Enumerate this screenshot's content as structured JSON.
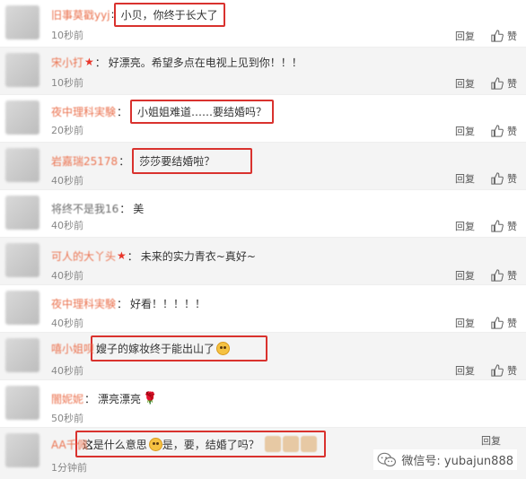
{
  "reply_label": "回复",
  "like_label": "赞",
  "comments": [
    {
      "user": "旧事莫戳yyj",
      "star": "",
      "sep": ":",
      "text": "小贝，你终于长大了",
      "time": "10秒前",
      "highlight": true
    },
    {
      "user": "宋小打",
      "star": "★",
      "sep": "：",
      "text": "好漂亮。希望多点在电视上见到你！！！",
      "time": "10秒前",
      "highlight": false
    },
    {
      "user": "夜中理科実験",
      "star": "",
      "sep": "：",
      "text": "小姐姐难道……要结婚吗？",
      "time": "20秒前",
      "highlight": true
    },
    {
      "user": "岩嘉瑞25178",
      "star": "",
      "sep": "：",
      "text": "莎莎要结婚啦？",
      "time": "40秒前",
      "highlight": true
    },
    {
      "user": "将终不是我16",
      "star": "",
      "sep": "：",
      "text": "美",
      "time": "40秒前",
      "highlight": false
    },
    {
      "user": "可人的大丫头",
      "star": "★",
      "sep": "：",
      "text": "未来的实力青衣~真好~",
      "time": "40秒前",
      "highlight": false
    },
    {
      "user": "夜中理科実験",
      "star": "",
      "sep": "：",
      "text": "好看！！！！！",
      "time": "40秒前",
      "highlight": false
    },
    {
      "user": "嘻小姐呗",
      "star": "",
      "sep": "：",
      "text": "嫂子的嫁妆终于能出山了",
      "time": "40秒前",
      "highlight": true
    },
    {
      "user": "闇妮妮",
      "star": "",
      "sep": "：",
      "text": "漂亮漂亮",
      "time": "50秒前",
      "highlight": false
    },
    {
      "user": "AA千佩",
      "star": "",
      "sep": "：",
      "text_before": "这是什么意思",
      "text_after": "是，要，结婚了吗？",
      "time": "1分钟前",
      "highlight": true
    }
  ],
  "watermark": {
    "text": "微信号: yubajun888"
  }
}
